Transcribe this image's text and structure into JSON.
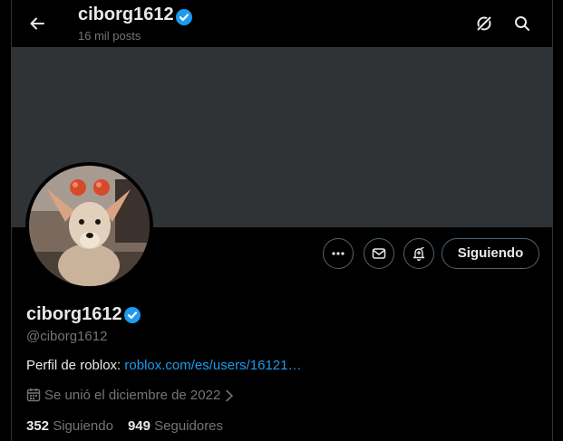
{
  "header": {
    "display_name": "ciborg1612",
    "post_count": "16 mil posts"
  },
  "profile": {
    "display_name": "ciborg1612",
    "handle": "@ciborg1612",
    "bio_prefix": "Perfil de roblox: ",
    "bio_link": "roblox.com/es/users/16121…",
    "joined": "Se unió el diciembre de 2022",
    "following_count": "352",
    "following_label": "Siguiendo",
    "followers_count": "949",
    "followers_label": "Seguidores"
  },
  "actions": {
    "follow_button_label": "Siguiendo"
  },
  "icons": {
    "back": "arrow-left-icon",
    "grok": "grok-icon",
    "search": "search-icon",
    "more": "more-icon",
    "message": "mail-icon",
    "notify": "bell-icon",
    "verified": "verified-badge-icon",
    "calendar": "calendar-icon"
  },
  "colors": {
    "background": "#000000",
    "banner": "#2f3336",
    "accent": "#1d9bf0",
    "muted_text": "#71767b"
  }
}
